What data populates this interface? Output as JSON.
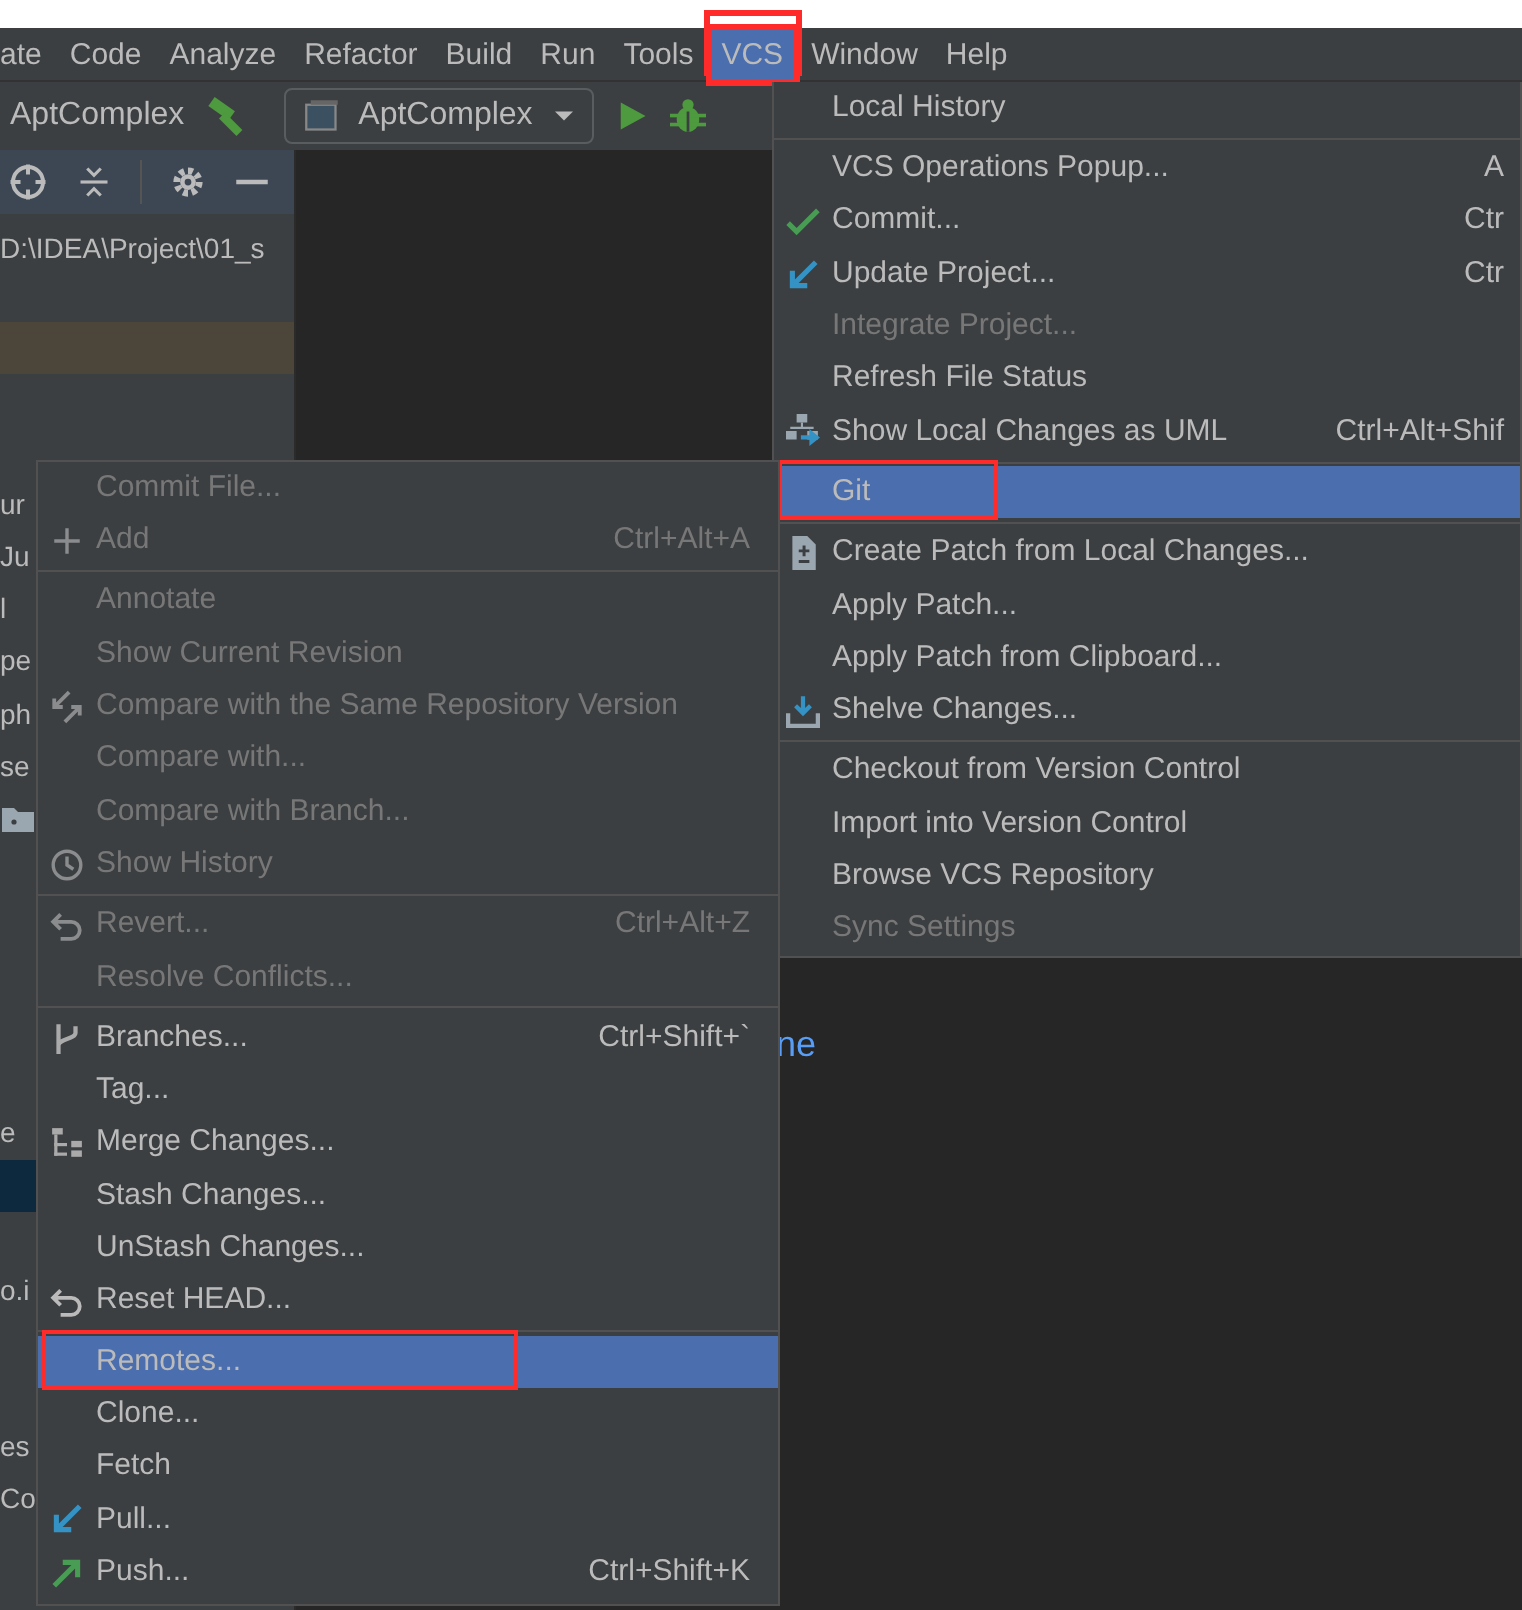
{
  "menu_bar": [
    {
      "label": "ate",
      "selected": false,
      "annotated": false
    },
    {
      "label": "Code",
      "selected": false,
      "annotated": false
    },
    {
      "label": "Analyze",
      "selected": false,
      "annotated": false
    },
    {
      "label": "Refactor",
      "selected": false,
      "annotated": false
    },
    {
      "label": "Build",
      "selected": false,
      "annotated": false
    },
    {
      "label": "Run",
      "selected": false,
      "annotated": false
    },
    {
      "label": "Tools",
      "selected": false,
      "annotated": false
    },
    {
      "label": "VCS",
      "selected": true,
      "annotated": true
    },
    {
      "label": "Window",
      "selected": false,
      "annotated": false
    },
    {
      "label": "Help",
      "selected": false,
      "annotated": false
    }
  ],
  "toolbar": {
    "project_name": "AptComplex",
    "run_configuration": "AptComplex"
  },
  "project_panel": {
    "path": "D:\\IDEA\\Project\\01_s",
    "tree_rows": [
      {
        "text": "ur",
        "selected": false
      },
      {
        "text": "Ju",
        "selected": false
      },
      {
        "text": "l",
        "selected": false
      },
      {
        "text": "pe",
        "selected": false
      },
      {
        "text": "ph",
        "selected": false
      },
      {
        "text": "se",
        "selected": false
      },
      {
        "kind": "folder",
        "selected": false
      },
      {
        "selected": false
      },
      {
        "selected": false
      },
      {
        "selected": false
      },
      {
        "selected": false
      },
      {
        "selected": false
      },
      {
        "text": "e",
        "selected": false
      },
      {
        "selected": true
      },
      {
        "selected": false
      },
      {
        "text": "o.i",
        "selected": false
      },
      {
        "selected": false
      },
      {
        "selected": false
      },
      {
        "text": "es",
        "selected": false
      },
      {
        "text": "Co",
        "selected": false
      }
    ]
  },
  "editor": {
    "text": "ne"
  },
  "vcs_menu": [
    [
      {
        "label": "Local History",
        "disabled": false,
        "selected": false,
        "annotated": false
      }
    ],
    [
      {
        "label": "VCS Operations Popup...",
        "shortcut": "A",
        "disabled": false,
        "selected": false,
        "annotated": false
      },
      {
        "label": "Commit...",
        "shortcut": "Ctr",
        "disabled": false,
        "selected": false,
        "annotated": false
      },
      {
        "label": "Update Project...",
        "shortcut": "Ctr",
        "disabled": false,
        "selected": false,
        "annotated": false
      },
      {
        "label": "Integrate Project...",
        "disabled": true,
        "selected": false,
        "annotated": false
      },
      {
        "label": "Refresh File Status",
        "disabled": false,
        "selected": false,
        "annotated": false
      },
      {
        "label": "Show Local Changes as UML",
        "shortcut": "Ctrl+Alt+Shif",
        "disabled": false,
        "selected": false,
        "annotated": false
      }
    ],
    [
      {
        "label": "Git",
        "disabled": false,
        "selected": true,
        "annotated": true
      }
    ],
    [
      {
        "label": "Create Patch from Local Changes...",
        "disabled": false,
        "selected": false,
        "annotated": false
      },
      {
        "label": "Apply Patch...",
        "disabled": false,
        "selected": false,
        "annotated": false
      },
      {
        "label": "Apply Patch from Clipboard...",
        "disabled": false,
        "selected": false,
        "annotated": false
      },
      {
        "label": "Shelve Changes...",
        "disabled": false,
        "selected": false,
        "annotated": false
      }
    ],
    [
      {
        "label": "Checkout from Version Control",
        "disabled": false,
        "selected": false,
        "annotated": false
      },
      {
        "label": "Import into Version Control",
        "disabled": false,
        "selected": false,
        "annotated": false
      },
      {
        "label": "Browse VCS Repository",
        "disabled": false,
        "selected": false,
        "annotated": false
      },
      {
        "label": "Sync Settings",
        "disabled": true,
        "selected": false,
        "annotated": false
      }
    ]
  ],
  "git_menu": [
    [
      {
        "label": "Commit File...",
        "disabled": true,
        "selected": false,
        "annotated": false
      },
      {
        "label": "Add",
        "shortcut": "Ctrl+Alt+A",
        "disabled": true,
        "selected": false,
        "annotated": false
      }
    ],
    [
      {
        "label": "Annotate",
        "disabled": true,
        "selected": false,
        "annotated": false
      },
      {
        "label": "Show Current Revision",
        "disabled": true,
        "selected": false,
        "annotated": false
      },
      {
        "label": "Compare with the Same Repository Version",
        "disabled": true,
        "selected": false,
        "annotated": false
      },
      {
        "label": "Compare with...",
        "disabled": true,
        "selected": false,
        "annotated": false
      },
      {
        "label": "Compare with Branch...",
        "disabled": true,
        "selected": false,
        "annotated": false
      },
      {
        "label": "Show History",
        "disabled": true,
        "selected": false,
        "annotated": false
      }
    ],
    [
      {
        "label": "Revert...",
        "shortcut": "Ctrl+Alt+Z",
        "disabled": true,
        "selected": false,
        "annotated": false
      },
      {
        "label": "Resolve Conflicts...",
        "disabled": true,
        "selected": false,
        "annotated": false
      }
    ],
    [
      {
        "label": "Branches...",
        "shortcut": "Ctrl+Shift+`",
        "disabled": false,
        "selected": false,
        "annotated": false
      },
      {
        "label": "Tag...",
        "disabled": false,
        "selected": false,
        "annotated": false
      },
      {
        "label": "Merge Changes...",
        "disabled": false,
        "selected": false,
        "annotated": false
      },
      {
        "label": "Stash Changes...",
        "disabled": false,
        "selected": false,
        "annotated": false
      },
      {
        "label": "UnStash Changes...",
        "disabled": false,
        "selected": false,
        "annotated": false
      },
      {
        "label": "Reset HEAD...",
        "disabled": false,
        "selected": false,
        "annotated": false
      }
    ],
    [
      {
        "label": "Remotes...",
        "disabled": false,
        "selected": true,
        "annotated": true
      },
      {
        "label": "Clone...",
        "disabled": false,
        "selected": false,
        "annotated": false
      },
      {
        "label": "Fetch",
        "disabled": false,
        "selected": false,
        "annotated": false
      },
      {
        "label": "Pull...",
        "disabled": false,
        "selected": false,
        "annotated": false
      },
      {
        "label": "Push...",
        "shortcut": "Ctrl+Shift+K",
        "disabled": false,
        "selected": false,
        "annotated": false
      }
    ]
  ]
}
